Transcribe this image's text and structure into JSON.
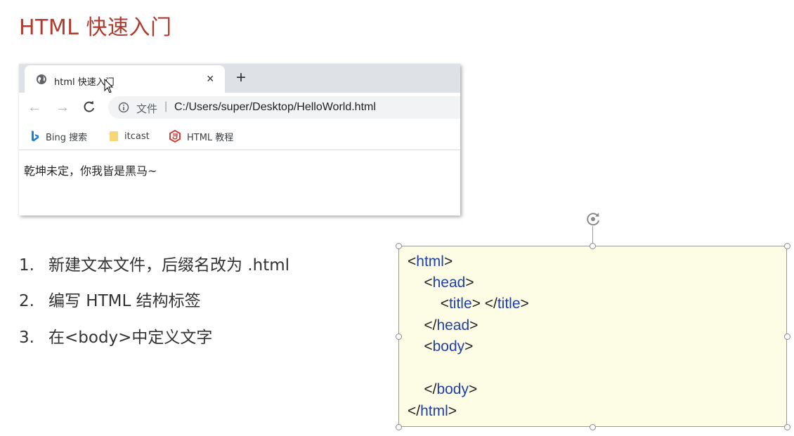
{
  "slide": {
    "title": "HTML 快速入门"
  },
  "browser": {
    "tab": {
      "title": "html 快速入门",
      "close": "×"
    },
    "new_tab": "+",
    "toolbar": {
      "back": "←",
      "forward": "→",
      "address_label": "文件",
      "address_separator": "|",
      "address_url": "C:/Users/super/Desktop/HelloWorld.html"
    },
    "bookmarks": [
      {
        "label": "Bing 搜索",
        "icon": "bing-icon"
      },
      {
        "label": "itcast",
        "icon": "folder-icon"
      },
      {
        "label": "HTML 教程",
        "icon": "html5-icon"
      }
    ],
    "page_text": "乾坤未定，你我皆是黑马~"
  },
  "steps": [
    {
      "num": "1.",
      "text": "新建文本文件，后缀名改为 .html"
    },
    {
      "num": "2.",
      "text": "编写 HTML 结构标签"
    },
    {
      "num": "3.",
      "text": "在<body>中定义文字"
    }
  ],
  "code": {
    "lines": [
      {
        "indent": "",
        "open": "<",
        "tag": "html",
        "close": ">",
        "rest": ""
      },
      {
        "indent": "    ",
        "open": "<",
        "tag": "head",
        "close": ">",
        "rest": ""
      },
      {
        "indent": "        ",
        "open": "<",
        "tag": "title",
        "close": "> </",
        "tag2": "title",
        "close2": ">"
      },
      {
        "indent": "    ",
        "open": "</",
        "tag": "head",
        "close": ">",
        "rest": ""
      },
      {
        "indent": "    ",
        "open": "<",
        "tag": "body",
        "close": ">",
        "rest": ""
      },
      {
        "indent": "",
        "open": "",
        "tag": "",
        "close": "",
        "rest": ""
      },
      {
        "indent": "    ",
        "open": "</",
        "tag": "body",
        "close": ">",
        "rest": ""
      },
      {
        "indent": "",
        "open": "</",
        "tag": "html",
        "close": ">",
        "rest": ""
      }
    ]
  },
  "colors": {
    "title": "#b03a2e",
    "code_tag": "#1f3fa8",
    "code_bg": "#fdfde6",
    "tabstrip": "#dee1e6"
  }
}
